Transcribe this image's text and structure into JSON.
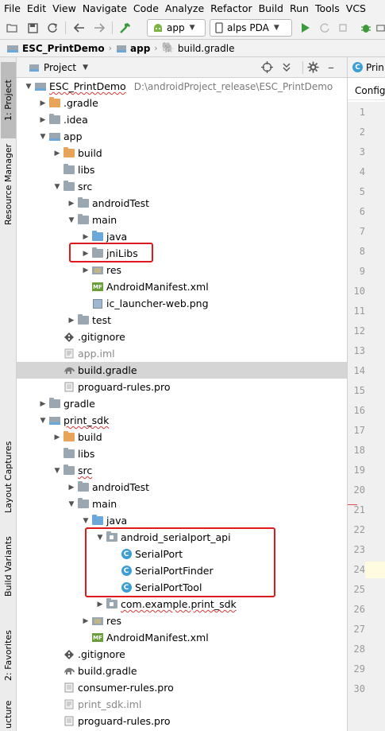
{
  "menu": [
    "File",
    "Edit",
    "View",
    "Navigate",
    "Code",
    "Analyze",
    "Refactor",
    "Build",
    "Run",
    "Tools",
    "VCS"
  ],
  "toolbar": {
    "config_label": "app",
    "device_label": "alps PDA"
  },
  "breadcrumb": {
    "project": "ESC_PrintDemo",
    "module": "app",
    "file": "build.gradle"
  },
  "left_tabs": {
    "project": "1: Project",
    "resource_manager": "Resource Manager",
    "layout_captures": "Layout Captures",
    "build_variants": "Build Variants",
    "favorites": "2: Favorites",
    "structure": "ucture"
  },
  "panel": {
    "view_label": "Project"
  },
  "tree": [
    {
      "label": "ESC_PrintDemo",
      "hint": "D:\\androidProject_release\\ESC_PrintDemo",
      "icon": "module",
      "depth": 0,
      "expanded": true
    },
    {
      "label": ".gradle",
      "icon": "folder-orange",
      "depth": 1,
      "expanded": false
    },
    {
      "label": ".idea",
      "icon": "folder",
      "depth": 1,
      "expanded": false
    },
    {
      "label": "app",
      "icon": "module",
      "depth": 1,
      "expanded": true
    },
    {
      "label": "build",
      "icon": "folder-orange",
      "depth": 2,
      "expanded": false
    },
    {
      "label": "libs",
      "icon": "folder",
      "depth": 2,
      "leaf": true
    },
    {
      "label": "src",
      "icon": "folder",
      "depth": 2,
      "expanded": true
    },
    {
      "label": "androidTest",
      "icon": "folder",
      "depth": 3,
      "expanded": false
    },
    {
      "label": "main",
      "icon": "folder",
      "depth": 3,
      "expanded": true
    },
    {
      "label": "java",
      "icon": "folder-blue",
      "depth": 4,
      "expanded": false
    },
    {
      "label": "jniLibs",
      "icon": "folder",
      "depth": 4,
      "expanded": false
    },
    {
      "label": "res",
      "icon": "folder-res",
      "depth": 4,
      "expanded": false
    },
    {
      "label": "AndroidManifest.xml",
      "icon": "manifest",
      "depth": 4,
      "leaf": true
    },
    {
      "label": "ic_launcher-web.png",
      "icon": "png",
      "depth": 4,
      "leaf": true
    },
    {
      "label": "test",
      "icon": "folder",
      "depth": 3,
      "expanded": false
    },
    {
      "label": ".gitignore",
      "icon": "git",
      "depth": 2,
      "leaf": true
    },
    {
      "label": "app.iml",
      "icon": "iml",
      "depth": 2,
      "leaf": true,
      "gray": true
    },
    {
      "label": "build.gradle",
      "icon": "gradle",
      "depth": 2,
      "leaf": true,
      "selected": true
    },
    {
      "label": "proguard-rules.pro",
      "icon": "file",
      "depth": 2,
      "leaf": true
    },
    {
      "label": "gradle",
      "icon": "folder",
      "depth": 1,
      "expanded": false
    },
    {
      "label": "print_sdk",
      "icon": "module",
      "depth": 1,
      "expanded": true,
      "squiggle": true
    },
    {
      "label": "build",
      "icon": "folder-orange",
      "depth": 2,
      "expanded": false
    },
    {
      "label": "libs",
      "icon": "folder",
      "depth": 2,
      "leaf": true
    },
    {
      "label": "src",
      "icon": "folder",
      "depth": 2,
      "expanded": true,
      "squiggle": true
    },
    {
      "label": "androidTest",
      "icon": "folder",
      "depth": 3,
      "expanded": false
    },
    {
      "label": "main",
      "icon": "folder",
      "depth": 3,
      "expanded": true
    },
    {
      "label": "java",
      "icon": "folder-blue",
      "depth": 4,
      "expanded": true
    },
    {
      "label": "android_serialport_api",
      "icon": "package",
      "depth": 5,
      "expanded": true
    },
    {
      "label": "SerialPort",
      "icon": "class",
      "depth": 6,
      "leaf": true
    },
    {
      "label": "SerialPortFinder",
      "icon": "class",
      "depth": 6,
      "leaf": true
    },
    {
      "label": "SerialPortTool",
      "icon": "class",
      "depth": 6,
      "leaf": true
    },
    {
      "label": "com.example.print_sdk",
      "icon": "package",
      "depth": 5,
      "expanded": false,
      "squiggle": true
    },
    {
      "label": "res",
      "icon": "folder-res",
      "depth": 4,
      "expanded": false
    },
    {
      "label": "AndroidManifest.xml",
      "icon": "manifest",
      "depth": 4,
      "leaf": true
    },
    {
      "label": ".gitignore",
      "icon": "git",
      "depth": 2,
      "leaf": true
    },
    {
      "label": "build.gradle",
      "icon": "gradle",
      "depth": 2,
      "leaf": true
    },
    {
      "label": "consumer-rules.pro",
      "icon": "file",
      "depth": 2,
      "leaf": true
    },
    {
      "label": "print_sdk.iml",
      "icon": "iml",
      "depth": 2,
      "leaf": true,
      "gray": true
    },
    {
      "label": "proguard-rules.pro",
      "icon": "file",
      "depth": 2,
      "leaf": true
    }
  ],
  "editor": {
    "tab_label": "Prin",
    "subtab_label": "Config",
    "line_numbers": [
      "1",
      "2",
      "3",
      "4",
      "5",
      "6",
      "7",
      "8",
      "9",
      "10",
      "11",
      "12",
      "13",
      "14",
      "15",
      "16",
      "17",
      "18",
      "19",
      "20",
      "21",
      "22",
      "23",
      "24",
      "25",
      "26",
      "27",
      "28",
      "29",
      "30"
    ],
    "current_line": "24"
  },
  "colors": {
    "highlight_box": "#e0191c",
    "selection": "#d5d5d5",
    "run_green": "#3c9a3c"
  }
}
